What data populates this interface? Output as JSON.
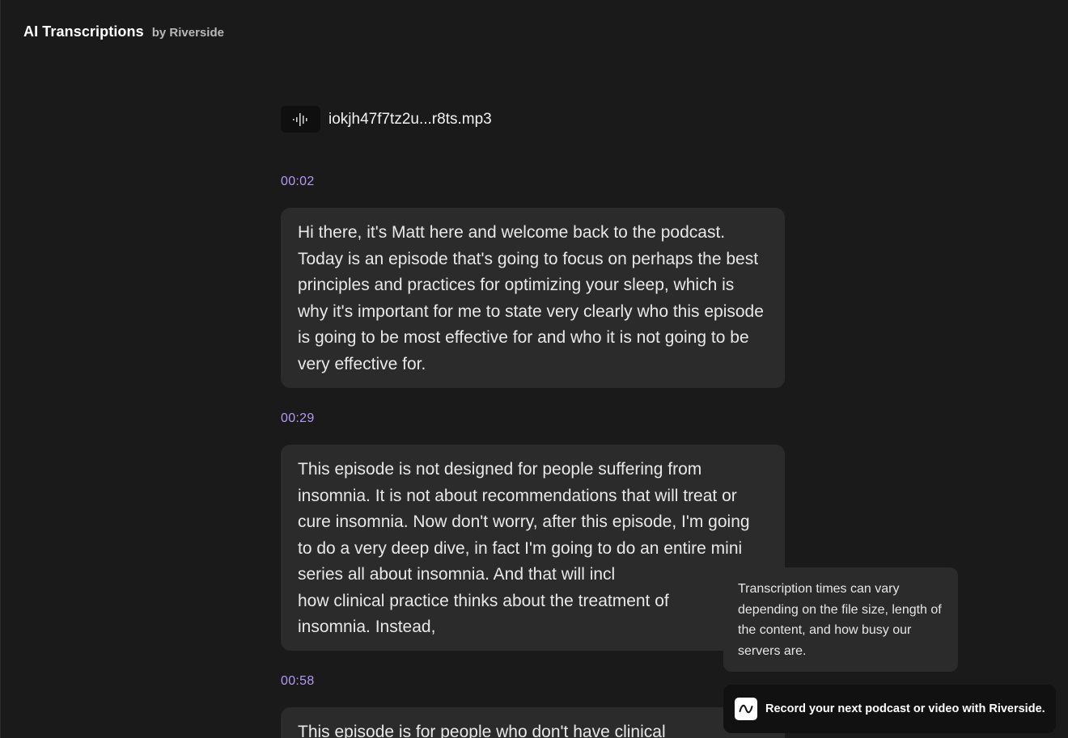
{
  "header": {
    "title": "AI Transcriptions",
    "subtitle": "by Riverside"
  },
  "file": {
    "icon": "waveform-icon",
    "name": "iokjh47f7tz2u...r8ts.mp3"
  },
  "transcript": [
    {
      "time": "00:02",
      "text": "Hi there, it's Matt here and welcome back to the podcast. Today is an episode that's going to focus on perhaps the best principles and practices for optimizing your sleep, which is why it's important for me to state very clearly who this episode is going to be most effective for and who it is not going to be very effective for."
    },
    {
      "time": "00:29",
      "text": "This episode is not designed for people suffering from insomnia. It is not about recommendations that will treat or cure insomnia. Now don't worry, after this episode, I'm going to do a very deep dive, in fact I'm going to do an entire mini series all about insomnia. And that will incl"
    },
    {
      "time": "00:58",
      "text": "This episode is for people who don't have clinical"
    }
  ],
  "segment2_line6": "how clinical practice thinks about the treatment of",
  "segment2_line7": "insomnia. Instead,",
  "tooltip": {
    "text": "Transcription times can vary depending on the file size, length of the content, and how busy our servers are."
  },
  "promo": {
    "icon": "riverside-logo-icon",
    "text": "Record your next podcast or video with Riverside."
  },
  "colors": {
    "background": "#1a1a1a",
    "bubble": "#2b2b2b",
    "accent_timestamp": "#b399f5",
    "promo_background": "#111111"
  }
}
